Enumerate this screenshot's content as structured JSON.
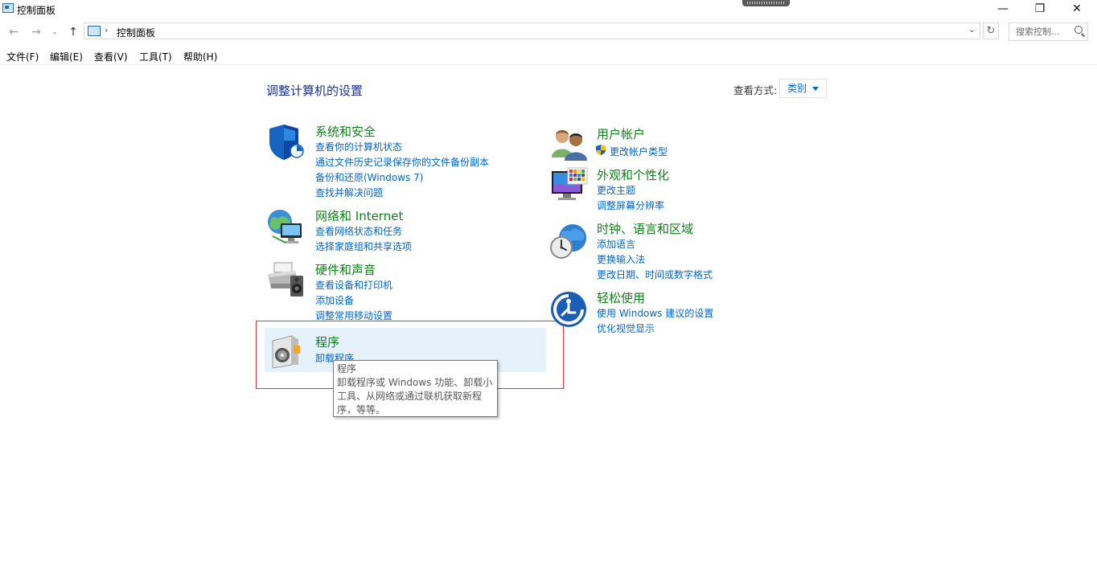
{
  "window": {
    "title": "控制面板",
    "min_glyph": "—",
    "max_glyph": "❐",
    "close_glyph": "✕"
  },
  "address": {
    "back_glyph": "←",
    "forward_glyph": "→",
    "recent_glyph": "⌄",
    "up_glyph": "↑",
    "separator": "›",
    "crumb": "控制面板",
    "dropdown_glyph": "⌄",
    "refresh_glyph": "↻",
    "search_placeholder": "搜索控制..."
  },
  "menu": {
    "file": "文件(F)",
    "edit": "编辑(E)",
    "view": "查看(V)",
    "tools": "工具(T)",
    "help": "帮助(H)"
  },
  "main": {
    "title": "调整计算机的设置",
    "view_by_label": "查看方式:",
    "view_by_value": "类别"
  },
  "categories": {
    "system_security": {
      "title": "系统和安全",
      "icon": "shield-icon",
      "links": [
        "查看你的计算机状态",
        "通过文件历史记录保存你的文件备份副本",
        "备份和还原(Windows 7)",
        "查找并解决问题"
      ]
    },
    "network": {
      "title": "网络和 Internet",
      "icon": "network-globe-icon",
      "links": [
        "查看网络状态和任务",
        "选择家庭组和共享选项"
      ]
    },
    "hardware": {
      "title": "硬件和声音",
      "icon": "printer-speaker-icon",
      "links": [
        "查看设备和打印机",
        "添加设备",
        "调整常用移动设置"
      ]
    },
    "programs": {
      "title": "程序",
      "icon": "programs-disc-icon",
      "links": [
        "卸载程序"
      ]
    },
    "user_accounts": {
      "title": "用户帐户",
      "icon": "users-icon",
      "links": [
        "更改帐户类型"
      ]
    },
    "appearance": {
      "title": "外观和个性化",
      "icon": "monitor-palette-icon",
      "links": [
        "更改主题",
        "调整屏幕分辨率"
      ]
    },
    "clock_region": {
      "title": "时钟、语言和区域",
      "icon": "clock-globe-icon",
      "links": [
        "添加语言",
        "更换输入法",
        "更改日期、时间或数字格式"
      ]
    },
    "ease_of_access": {
      "title": "轻松使用",
      "icon": "ease-of-access-icon",
      "links": [
        "使用 Windows 建议的设置",
        "优化视觉显示"
      ]
    }
  },
  "tooltip": {
    "lines": [
      "程序",
      "卸载程序或 Windows 功能、卸载小",
      "工具、从网络或通过联机获取新程",
      "序，等等。"
    ]
  },
  "colors": {
    "category_title": "#11801a",
    "link": "#0066cc",
    "page_title": "#1e3287",
    "hover_bg": "#e5f1fb",
    "focus_border": "#d63c3c"
  }
}
